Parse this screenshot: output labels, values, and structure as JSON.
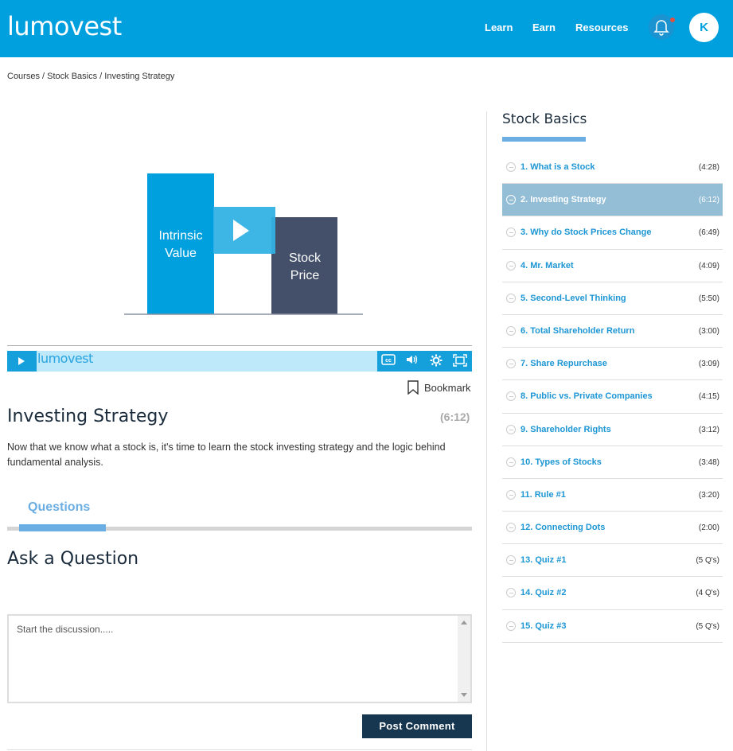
{
  "header": {
    "logo": "lumovest",
    "nav": [
      "Learn",
      "Earn",
      "Resources"
    ],
    "avatar_initial": "K",
    "brand_color": "#009fde"
  },
  "breadcrumb": [
    "Courses",
    "Stock Basics",
    "Investing Strategy"
  ],
  "breadcrumb_sep": " / ",
  "video": {
    "thumbnail_labels": {
      "left_bar": [
        "Intrinsic",
        "Value"
      ],
      "right_bar": [
        "Stock",
        "Price"
      ]
    },
    "controls": {
      "brand": "lumovest",
      "icons": [
        "cc-icon",
        "volume-icon",
        "settings-icon",
        "fullscreen-icon"
      ]
    }
  },
  "bookmark_label": "Bookmark",
  "lesson": {
    "title": "Investing Strategy",
    "duration": "(6:12)",
    "description": "Now that we know what a stock is, it's time to learn the stock investing strategy and the logic behind fundamental analysis."
  },
  "tabs": [
    {
      "label": "Questions",
      "active": true
    }
  ],
  "ask": {
    "title": "Ask a Question",
    "placeholder": "Start the discussion.....",
    "post_label": "Post Comment"
  },
  "sidebar": {
    "title": "Stock Basics",
    "items": [
      {
        "label": "1. What is a Stock",
        "duration": "(4:28)"
      },
      {
        "label": "2. Investing Strategy",
        "duration": "(6:12)",
        "active": true
      },
      {
        "label": "3. Why do Stock Prices Change",
        "duration": "(6:49)"
      },
      {
        "label": "4. Mr. Market",
        "duration": "(4:09)"
      },
      {
        "label": "5. Second-Level Thinking",
        "duration": "(5:50)"
      },
      {
        "label": "6. Total Shareholder Return",
        "duration": "(3:00)"
      },
      {
        "label": "7. Share Repurchase",
        "duration": "(3:09)"
      },
      {
        "label": "8. Public vs. Private Companies",
        "duration": "(4:15)"
      },
      {
        "label": "9. Shareholder Rights",
        "duration": "(3:12)"
      },
      {
        "label": "10. Types of Stocks",
        "duration": "(3:48)"
      },
      {
        "label": "11. Rule #1",
        "duration": "(3:20)"
      },
      {
        "label": "12. Connecting Dots",
        "duration": "(2:00)"
      },
      {
        "label": "13. Quiz #1",
        "duration": "(5 Q's)"
      },
      {
        "label": "14. Quiz #2",
        "duration": "(4 Q's)"
      },
      {
        "label": "15. Quiz #3",
        "duration": "(5 Q's)"
      }
    ]
  }
}
